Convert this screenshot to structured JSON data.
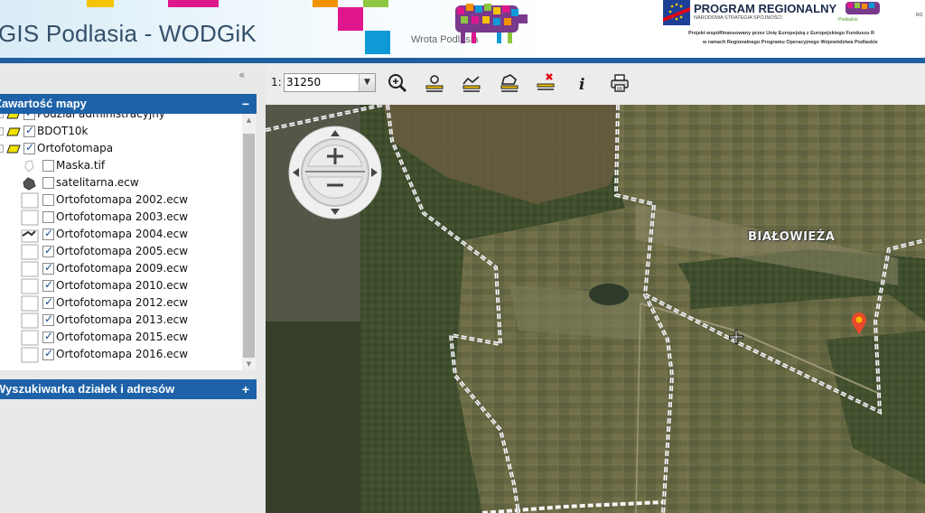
{
  "banner": {
    "title": "GIS Podlasia - WODGiK",
    "wrota_label": "Wrota Podlasia",
    "program_title": "PROGRAM REGIONALNY",
    "program_subtitle": "NARODOWA STRATEGIA SPÓJNOŚCI",
    "podlaskie_label": "Podlaskie",
    "ro_label": "RO",
    "project_line1": "Projekt współfinansowany przez Unię Europejską z Europejskiego Funduszu R",
    "project_line2": "w ramach Regionalnego Programu Operacyjnego Województwa Podlaskie",
    "accent_color": "#1f5fa0"
  },
  "left_panel": {
    "collapse_label": "«",
    "layers_header": "Zawartość mapy",
    "layers_toggle": "−",
    "search_header": "Wyszukiwarka działek i adresów",
    "search_toggle": "+",
    "layers": [
      {
        "label": "Podział administracyjny",
        "checked": true
      },
      {
        "label": "BDOT10k",
        "checked": true
      },
      {
        "label": "Ortofotomapa",
        "checked": true
      },
      {
        "label": "Maska.tif",
        "checked": false
      },
      {
        "label": "satelitarna.ecw",
        "checked": false
      },
      {
        "label": "Ortofotomapa 2002.ecw",
        "checked": false
      },
      {
        "label": "Ortofotomapa 2003.ecw",
        "checked": false
      },
      {
        "label": "Ortofotomapa 2004.ecw",
        "checked": true
      },
      {
        "label": "Ortofotomapa 2005.ecw",
        "checked": true
      },
      {
        "label": "Ortofotomapa 2009.ecw",
        "checked": true
      },
      {
        "label": "Ortofotomapa 2010.ecw",
        "checked": true
      },
      {
        "label": "Ortofotomapa 2012.ecw",
        "checked": true
      },
      {
        "label": "Ortofotomapa 2013.ecw",
        "checked": true
      },
      {
        "label": "Ortofotomapa 2015.ecw",
        "checked": true
      },
      {
        "label": "Ortofotomapa 2016.ecw",
        "checked": true
      }
    ]
  },
  "toolbar": {
    "scale_prefix": "1:",
    "scale_value": "31250",
    "tools": [
      "zoom-magnifier-icon",
      "measure-point-icon",
      "measure-line-icon",
      "measure-area-icon",
      "clear-measure-icon",
      "info-icon",
      "print-icon"
    ]
  },
  "map": {
    "place_label": "BIAŁOWIEŻA",
    "pin_color": "#e8492a"
  }
}
